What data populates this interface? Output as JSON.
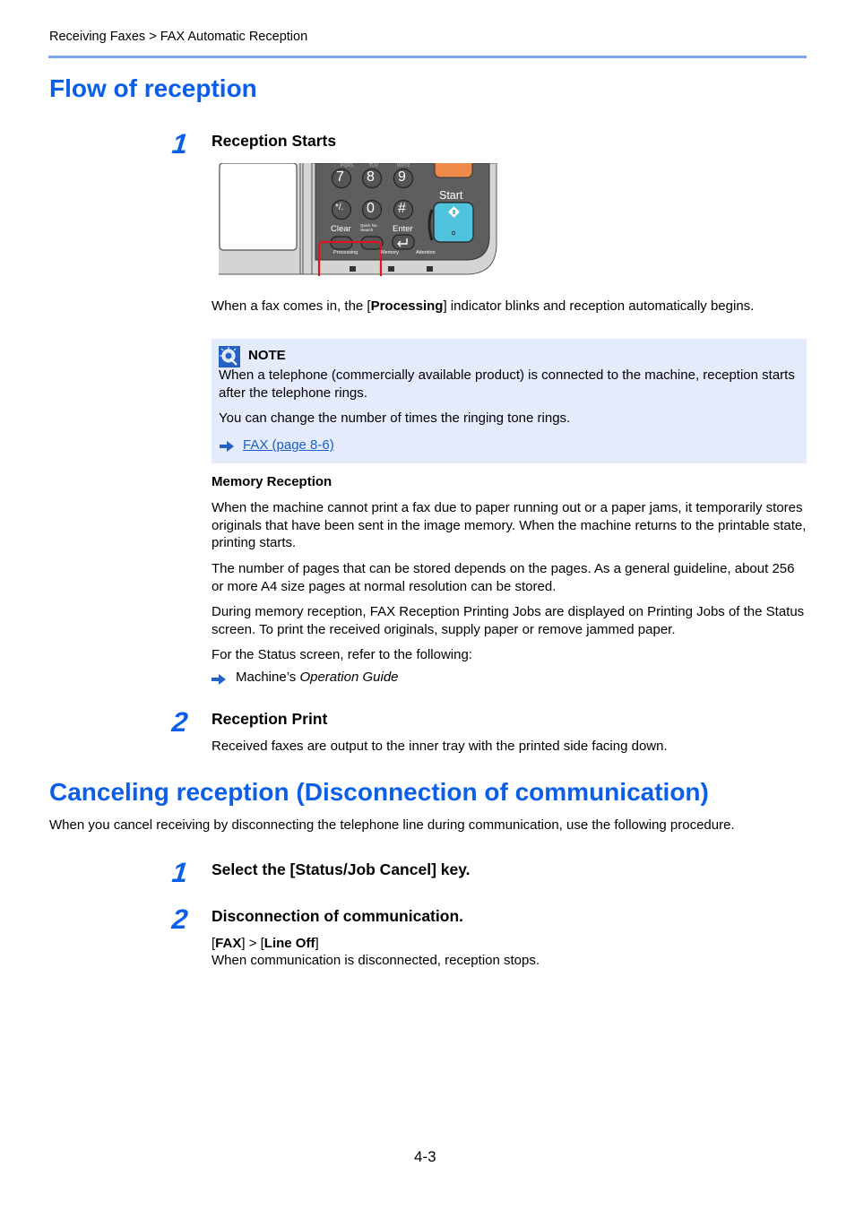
{
  "header": {
    "breadcrumb": "Receiving Faxes > FAX Automatic Reception"
  },
  "section1": {
    "title": "Flow of reception",
    "step1": {
      "number": "1",
      "heading": "Reception Starts",
      "panel": {
        "keys": [
          "7",
          "8",
          "9",
          "*/.",
          "0",
          "#"
        ],
        "labels": {
          "start": "Start",
          "clear": "Clear",
          "quick_no_search": "Quick No. Search",
          "enter": "Enter",
          "processing": "Processing",
          "memory": "Memory",
          "attention": "Attention"
        }
      },
      "desc_prefix": "When a fax comes in, the [",
      "desc_bold": "Processing",
      "desc_suffix": "] indicator blinks and reception automatically begins."
    },
    "note": {
      "label": "NOTE",
      "para1": "When a telephone (commercially available product) is connected to the machine, reception starts after the telephone rings.",
      "para2": "You can change the number of times the ringing tone rings.",
      "link": "FAX (page 8-6)"
    },
    "memory": {
      "heading": "Memory Reception",
      "para1": "When the machine cannot print a fax due to paper running out or a paper jams, it temporarily stores originals that have been sent in the image memory. When the machine returns to the printable state, printing starts.",
      "para2": "The number of pages that can be stored depends on the pages. As a general guideline, about 256 or more A4 size pages at normal resolution can be stored.",
      "para3": "During memory reception, FAX Reception Printing Jobs are displayed on Printing Jobs of the Status screen. To print the received originals, supply paper or remove jammed paper.",
      "para4": "For the Status screen, refer to the following:",
      "ref_prefix": "Machine’s ",
      "ref_italic": "Operation Guide"
    },
    "step2": {
      "number": "2",
      "heading": "Reception Print",
      "desc": "Received faxes are output to the inner tray with the printed side facing down."
    }
  },
  "section2": {
    "title": "Canceling reception (Disconnection of communication)",
    "intro": "When you cancel receiving by disconnecting the telephone line during communication, use the following procedure.",
    "step1": {
      "number": "1",
      "heading": "Select the [Status/Job Cancel] key."
    },
    "step2": {
      "number": "2",
      "heading": "Disconnection of communication.",
      "path_open1": "[",
      "path_bold1": "FAX",
      "path_mid": "] > [",
      "path_bold2": "Line Off",
      "path_close": "]",
      "desc": "When communication is disconnected, reception stops."
    }
  },
  "footer": {
    "page_number": "4-3"
  },
  "colors": {
    "heading_blue": "#0b5ee8",
    "rule_blue": "#7aa7ef",
    "note_bg": "#e4ebfa",
    "highlight_red": "#e0141e",
    "start_key": "#4fc3dc",
    "stop_key": "#f08a4b",
    "panel_gray": "#5d5d5d"
  }
}
